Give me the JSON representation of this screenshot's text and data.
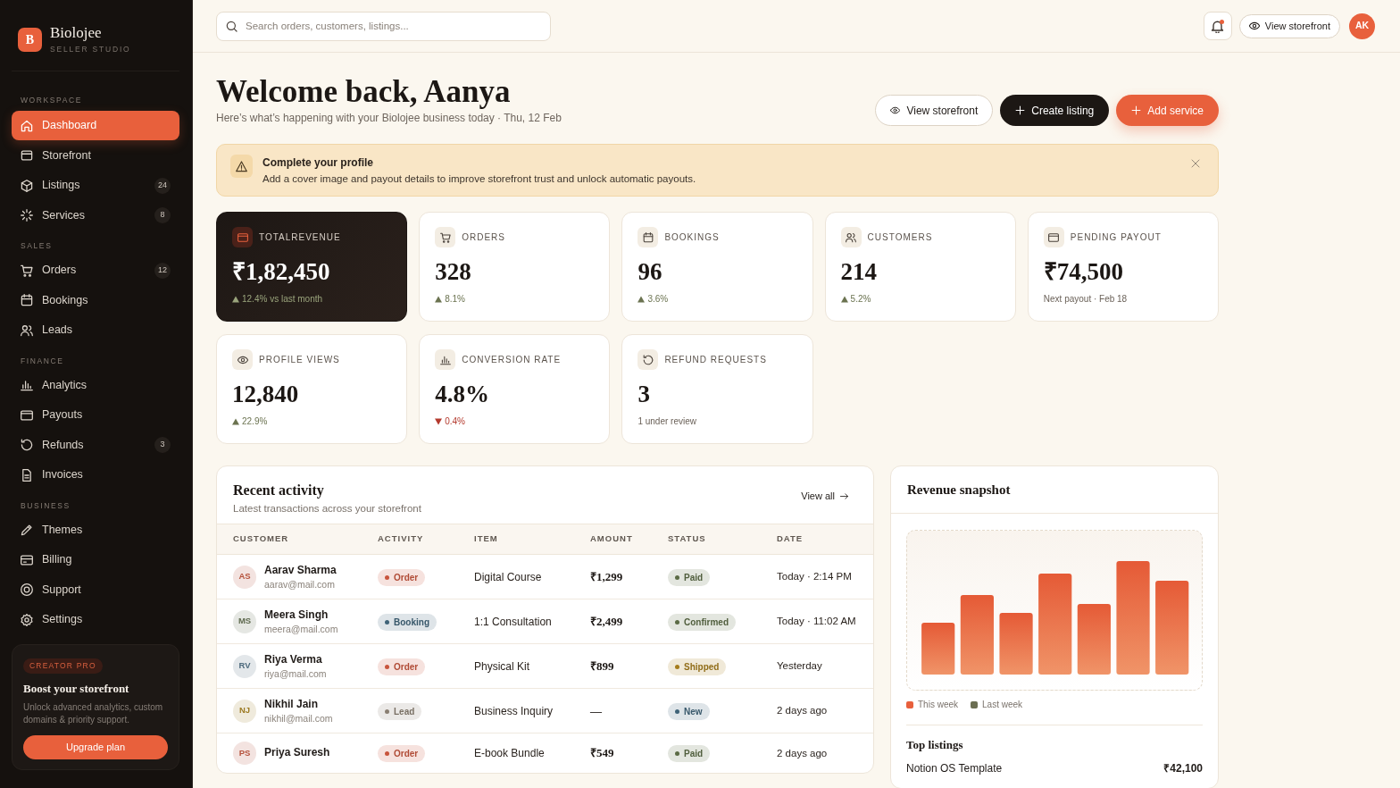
{
  "sidebar": {
    "brand": {
      "logo": "B",
      "name": "Biolojee",
      "tagline": "SELLER STUDIO"
    },
    "sections": [
      {
        "heading": "WORKSPACE",
        "items": [
          {
            "label": "Dashboard",
            "selected": true
          },
          {
            "label": "Storefront",
            "selected": false
          },
          {
            "label": "Listings",
            "selected": false,
            "count": "24"
          },
          {
            "label": "Services",
            "selected": false,
            "count": "8"
          }
        ]
      },
      {
        "heading": "SALES",
        "items": [
          {
            "label": "Orders",
            "selected": false,
            "count": "12"
          },
          {
            "label": "Bookings",
            "selected": false
          },
          {
            "label": "Leads",
            "selected": false
          }
        ]
      },
      {
        "heading": "FINANCE",
        "items": [
          {
            "label": "Analytics",
            "selected": false
          },
          {
            "label": "Payouts",
            "selected": false
          },
          {
            "label": "Refunds",
            "selected": false,
            "count": "3"
          },
          {
            "label": "Invoices",
            "selected": false
          }
        ]
      },
      {
        "heading": "BUSINESS",
        "items": [
          {
            "label": "Themes",
            "selected": false
          },
          {
            "label": "Billing",
            "selected": false
          },
          {
            "label": "Support",
            "selected": false
          },
          {
            "label": "Settings",
            "selected": false
          }
        ]
      }
    ],
    "promo": {
      "tag": "CREATOR PRO",
      "title": "Boost your storefront",
      "text": "Unlock advanced analytics, custom domains & priority support.",
      "button": "Upgrade plan"
    }
  },
  "topbar": {
    "search": {
      "placeholder": "Search orders, customers, listings..."
    },
    "notifications": {
      "unread": true
    },
    "storefront_button": "View storefront",
    "avatar": "AK"
  },
  "header": {
    "title": "Welcome back, Aanya",
    "subtitle": "Here’s what’s happening with your Biolojee business today · Thu, 12 Feb",
    "buttons": [
      {
        "label": "View storefront",
        "kind": "outline"
      },
      {
        "label": "Create listing",
        "kind": "dark"
      },
      {
        "label": "Add service",
        "kind": "accent"
      }
    ]
  },
  "alert": {
    "title": "Complete your profile",
    "text": "Add a cover image and payout details to improve storefront trust and unlock automatic payouts."
  },
  "stats": [
    {
      "label": "TOTALREVENUE",
      "value": "₹1,82,450",
      "featured": true,
      "kind": "rise",
      "note": "12.4% vs last month"
    },
    {
      "label": "ORDERS",
      "value": "328",
      "featured": false,
      "kind": "rise",
      "note": "8.1%"
    },
    {
      "label": "BOOKINGS",
      "value": "96",
      "featured": false,
      "kind": "rise",
      "note": "3.6%"
    },
    {
      "label": "CUSTOMERS",
      "value": "214",
      "featured": false,
      "kind": "rise",
      "note": "5.2%"
    },
    {
      "label": "PENDING PAYOUT",
      "value": "₹74,500",
      "featured": false,
      "kind": "note",
      "note": "Next payout · Feb 18"
    },
    {
      "label": "PROFILE VIEWS",
      "value": "12,840",
      "featured": false,
      "kind": "rise",
      "note": "22.9%"
    },
    {
      "label": "CONVERSION RATE",
      "value": "4.8%",
      "featured": false,
      "kind": "fall",
      "note": "0.4%"
    },
    {
      "label": "REFUND REQUESTS",
      "value": "3",
      "featured": false,
      "kind": "note",
      "note": "1 under review"
    }
  ],
  "recent_activity": {
    "title": "Recent activity",
    "subtitle": "Latest transactions across your storefront",
    "link": "View all",
    "columns": [
      "CUSTOMER",
      "ACTIVITY",
      "ITEM",
      "AMOUNT",
      "STATUS",
      "DATE"
    ],
    "rows": [
      {
        "initials": "AS",
        "color": "#b5523c",
        "name": "Aarav Sharma",
        "email": "aarav@mail.com",
        "activity": {
          "label": "Order",
          "color": "#c8553d"
        },
        "item": "Digital Course",
        "amount": "₹1,299",
        "status": {
          "label": "Paid",
          "color": "#5b6b45"
        },
        "date": "Today · 2:14 PM"
      },
      {
        "initials": "MS",
        "color": "#5f6a4f",
        "name": "Meera Singh",
        "email": "meera@mail.com",
        "activity": {
          "label": "Booking",
          "color": "#3f6378"
        },
        "item": "1:1 Consultation",
        "amount": "₹2,499",
        "status": {
          "label": "Confirmed",
          "color": "#5b6b45"
        },
        "date": "Today · 11:02 AM"
      },
      {
        "initials": "RV",
        "color": "#4d6a7d",
        "name": "Riya Verma",
        "email": "riya@mail.com",
        "activity": {
          "label": "Order",
          "color": "#c8553d"
        },
        "item": "Physical Kit",
        "amount": "₹899",
        "status": {
          "label": "Shipped",
          "color": "#a57c1c"
        },
        "date": "Yesterday"
      },
      {
        "initials": "NJ",
        "color": "#9c7a22",
        "name": "Nikhil Jain",
        "email": "nikhil@mail.com",
        "activity": {
          "label": "Lead",
          "color": "#8a7f72"
        },
        "item": "Business Inquiry",
        "amount": "—",
        "status": {
          "label": "New",
          "color": "#3f6378"
        },
        "date": "2 days ago"
      },
      {
        "initials": "PS",
        "color": "#b5523c",
        "name": "Priya Suresh",
        "activity": {
          "label": "Order",
          "color": "#c8553d"
        },
        "item": "E-book Bundle",
        "amount": "₹549",
        "status": {
          "label": "Paid",
          "color": "#5b6b45"
        },
        "date": "2 days ago"
      }
    ]
  },
  "revenue_snapshot": {
    "title": "Revenue snapshot",
    "legend": [
      {
        "label": "This week",
        "color": "#e8603c"
      },
      {
        "label": "Last week",
        "color": "#6b6e52"
      }
    ],
    "top_listings": {
      "title": "Top listings",
      "items": [
        {
          "name": "Notion OS Template",
          "amount": "₹42,100"
        }
      ]
    }
  }
}
